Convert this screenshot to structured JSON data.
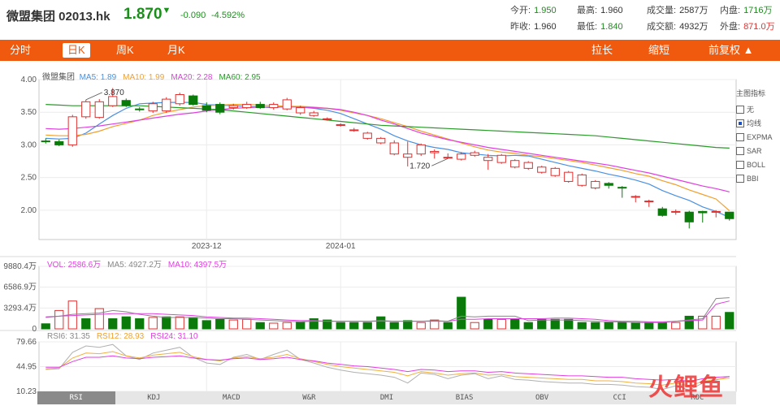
{
  "header": {
    "name": "微盟集团 02013.hk",
    "price": "1.870",
    "price_arrow": "▼",
    "change": "-0.090",
    "change_pct": "-4.592%",
    "stats": [
      {
        "label": "今开:",
        "value": "1.950",
        "color": "#1a8f1a"
      },
      {
        "label": "最高:",
        "value": "1.960",
        "color": "#333333"
      },
      {
        "label": "成交量:",
        "value": "2587万",
        "color": "#333333"
      },
      {
        "label": "内盘:",
        "value": "1716万",
        "color": "#1a8f1a"
      },
      {
        "label": "昨收:",
        "value": "1.960",
        "color": "#333333"
      },
      {
        "label": "最低:",
        "value": "1.840",
        "color": "#1a8f1a"
      },
      {
        "label": "成交额:",
        "value": "4932万",
        "color": "#333333"
      },
      {
        "label": "外盘:",
        "value": "871.0万",
        "color": "#e03030"
      }
    ]
  },
  "tabs": [
    "分时",
    "日K",
    "周K",
    "月K"
  ],
  "active_tab": "日K",
  "right_tabs": [
    "拉长",
    "缩短",
    "前复权 ▲"
  ],
  "side_panel": {
    "title": "主图指标",
    "options": [
      {
        "label": "无",
        "checked": false
      },
      {
        "label": "均线",
        "checked": true
      },
      {
        "label": "EXPMA",
        "checked": false
      },
      {
        "label": "SAR",
        "checked": false
      },
      {
        "label": "BOLL",
        "checked": false
      },
      {
        "label": "BBI",
        "checked": false
      }
    ]
  },
  "bottom_tabs": [
    "RSI",
    "KDJ",
    "MACD",
    "W&R",
    "DMI",
    "BIAS",
    "OBV",
    "CCI",
    "ROC"
  ],
  "active_bottom_tab": "RSI",
  "watermark": "火鲤鱼",
  "colors": {
    "up": "#e03030",
    "down": "#0a7a0a",
    "ma5": "#4a90e2",
    "ma10": "#f0a030",
    "ma20": "#e040e0",
    "ma60": "#2a9a2a",
    "accent": "#f05a0f"
  },
  "chart_data": [
    {
      "type": "candlestick",
      "title": "微盟集团",
      "legend": [
        {
          "name": "MA5",
          "value": "1.89"
        },
        {
          "name": "MA10",
          "value": "1.99"
        },
        {
          "name": "MA20",
          "value": "2.28"
        },
        {
          "name": "MA60",
          "value": "2.95"
        }
      ],
      "ylim": [
        1.55,
        4.0
      ],
      "yticks": [
        "4.00",
        "3.50",
        "3.00",
        "2.50",
        "2.00"
      ],
      "xticks": [
        {
          "label": "2023-12",
          "index": 12
        },
        {
          "label": "2024-01",
          "index": 22
        }
      ],
      "annotations": [
        {
          "text": "3.870",
          "index": 3
        },
        {
          "text": "1.720",
          "index": 30
        }
      ],
      "open": [
        3.06,
        3.05,
        3.0,
        3.43,
        3.42,
        3.6,
        3.68,
        3.55,
        3.52,
        3.52,
        3.63,
        3.75,
        3.6,
        3.62,
        3.57,
        3.57,
        3.62,
        3.57,
        3.55,
        3.49,
        3.45,
        3.4,
        3.31,
        3.23,
        3.1,
        3.03,
        2.86,
        2.81,
        2.86,
        2.88,
        2.81,
        2.78,
        2.84,
        2.76,
        2.73,
        2.66,
        2.64,
        2.58,
        2.53,
        2.44,
        2.38,
        2.34,
        2.41,
        2.35,
        2.21,
        2.14,
        2.02,
        1.98,
        1.97,
        1.98,
        1.98,
        1.97
      ],
      "close": [
        3.05,
        3.0,
        3.43,
        3.66,
        3.66,
        3.74,
        3.6,
        3.54,
        3.63,
        3.7,
        3.77,
        3.62,
        3.53,
        3.5,
        3.6,
        3.62,
        3.57,
        3.62,
        3.69,
        3.57,
        3.49,
        3.4,
        3.31,
        3.23,
        3.18,
        3.1,
        3.03,
        2.86,
        3.0,
        2.9,
        2.81,
        2.86,
        2.88,
        2.81,
        2.84,
        2.76,
        2.73,
        2.66,
        2.64,
        2.58,
        2.54,
        2.44,
        2.38,
        2.34,
        2.21,
        2.14,
        1.92,
        1.98,
        1.82,
        1.96,
        1.98,
        1.87
      ],
      "high": [
        3.1,
        3.08,
        3.46,
        3.69,
        3.7,
        3.87,
        3.71,
        3.58,
        3.66,
        3.73,
        3.8,
        3.77,
        3.65,
        3.65,
        3.63,
        3.66,
        3.66,
        3.65,
        3.72,
        3.6,
        3.52,
        3.42,
        3.33,
        3.26,
        3.2,
        3.12,
        3.07,
        3.05,
        3.02,
        2.93,
        2.87,
        2.89,
        2.91,
        2.86,
        2.86,
        2.78,
        2.75,
        2.68,
        2.66,
        2.6,
        2.56,
        2.46,
        2.43,
        2.37,
        2.23,
        2.16,
        2.05,
        2.01,
        1.99,
        1.99,
        2.0,
        1.96
      ],
      "low": [
        3.02,
        2.98,
        2.97,
        3.4,
        3.4,
        3.58,
        3.58,
        3.51,
        3.49,
        3.49,
        3.6,
        3.6,
        3.5,
        3.47,
        3.54,
        3.55,
        3.55,
        3.54,
        3.53,
        3.46,
        3.43,
        3.37,
        3.28,
        3.2,
        3.08,
        3.01,
        2.84,
        2.67,
        2.83,
        2.79,
        2.79,
        2.76,
        2.82,
        2.62,
        2.71,
        2.64,
        2.62,
        2.56,
        2.51,
        2.42,
        2.36,
        2.32,
        2.33,
        2.19,
        2.12,
        2.05,
        1.9,
        1.93,
        1.72,
        1.81,
        1.89,
        1.84
      ],
      "series": [
        {
          "name": "MA5",
          "values": [
            3.1,
            3.09,
            3.1,
            3.18,
            3.32,
            3.45,
            3.56,
            3.63,
            3.64,
            3.65,
            3.65,
            3.65,
            3.62,
            3.61,
            3.6,
            3.59,
            3.58,
            3.57,
            3.59,
            3.58,
            3.56,
            3.53,
            3.48,
            3.4,
            3.32,
            3.24,
            3.14,
            3.06,
            3.0,
            2.96,
            2.93,
            2.88,
            2.86,
            2.84,
            2.83,
            2.84,
            2.83,
            2.78,
            2.73,
            2.68,
            2.64,
            2.6,
            2.55,
            2.51,
            2.46,
            2.4,
            2.3,
            2.22,
            2.15,
            2.05,
            1.98,
            1.89
          ]
        },
        {
          "name": "MA10",
          "values": [
            3.15,
            3.14,
            3.14,
            3.16,
            3.21,
            3.28,
            3.33,
            3.38,
            3.45,
            3.5,
            3.54,
            3.58,
            3.6,
            3.61,
            3.62,
            3.62,
            3.61,
            3.6,
            3.59,
            3.59,
            3.58,
            3.56,
            3.53,
            3.49,
            3.45,
            3.4,
            3.34,
            3.28,
            3.21,
            3.15,
            3.09,
            3.03,
            2.97,
            2.92,
            2.89,
            2.87,
            2.84,
            2.82,
            2.79,
            2.76,
            2.73,
            2.69,
            2.65,
            2.61,
            2.56,
            2.52,
            2.45,
            2.39,
            2.31,
            2.24,
            2.17,
            1.99
          ]
        },
        {
          "name": "MA20",
          "values": [
            3.25,
            3.24,
            3.25,
            3.27,
            3.29,
            3.32,
            3.35,
            3.38,
            3.41,
            3.44,
            3.47,
            3.49,
            3.52,
            3.54,
            3.56,
            3.57,
            3.58,
            3.58,
            3.58,
            3.58,
            3.57,
            3.56,
            3.54,
            3.5,
            3.45,
            3.38,
            3.32,
            3.25,
            3.18,
            3.13,
            3.08,
            3.04,
            3.0,
            2.96,
            2.93,
            2.9,
            2.87,
            2.84,
            2.81,
            2.78,
            2.75,
            2.72,
            2.69,
            2.65,
            2.61,
            2.57,
            2.52,
            2.47,
            2.42,
            2.37,
            2.33,
            2.28
          ]
        },
        {
          "name": "MA60",
          "values": [
            3.62,
            3.61,
            3.6,
            3.6,
            3.6,
            3.6,
            3.6,
            3.6,
            3.59,
            3.58,
            3.57,
            3.56,
            3.55,
            3.54,
            3.52,
            3.5,
            3.48,
            3.46,
            3.44,
            3.42,
            3.4,
            3.38,
            3.36,
            3.34,
            3.32,
            3.3,
            3.29,
            3.28,
            3.27,
            3.26,
            3.25,
            3.24,
            3.23,
            3.22,
            3.21,
            3.2,
            3.19,
            3.18,
            3.17,
            3.16,
            3.15,
            3.14,
            3.12,
            3.1,
            3.08,
            3.06,
            3.04,
            3.02,
            3.0,
            2.98,
            2.96,
            2.95
          ]
        }
      ]
    },
    {
      "type": "bar",
      "title": "VOL",
      "legend": [
        {
          "name": "VOL",
          "value": "2586.6万"
        },
        {
          "name": "MA5",
          "value": "4927.2万"
        },
        {
          "name": "MA10",
          "value": "4397.5万"
        }
      ],
      "yticks": [
        "9880.4万",
        "6586.9万",
        "3293.4万",
        "0"
      ],
      "ylim": [
        0,
        9880.4
      ],
      "values": [
        800,
        2900,
        4400,
        1600,
        3200,
        1600,
        1900,
        1600,
        1800,
        1900,
        1900,
        1800,
        1300,
        1500,
        1400,
        1500,
        1000,
        900,
        1000,
        1100,
        1600,
        1400,
        1000,
        1000,
        1000,
        1900,
        1000,
        1300,
        1000,
        1400,
        1000,
        5000,
        1000,
        1500,
        1500,
        1500,
        1000,
        1500,
        1500,
        1500,
        1000,
        1000,
        1000,
        1000,
        1000,
        1000,
        1000,
        1000,
        2000,
        2000,
        2000,
        2600
      ],
      "series": [
        {
          "name": "MA5",
          "values": [
            1800,
            2000,
            2300,
            2400,
            2500,
            2900,
            2700,
            2300,
            2000,
            1800,
            1800,
            1800,
            1700,
            1600,
            1600,
            1500,
            1400,
            1300,
            1200,
            1100,
            1200,
            1200,
            1200,
            1200,
            1200,
            1300,
            1200,
            1200,
            1200,
            1300,
            1200,
            2000,
            1900,
            2000,
            2000,
            2000,
            1300,
            1400,
            1400,
            1400,
            1300,
            1200,
            1100,
            1100,
            1000,
            1000,
            1000,
            1200,
            1400,
            1600,
            4800,
            4927
          ]
        },
        {
          "name": "MA10",
          "values": [
            1900,
            2000,
            2100,
            2200,
            2300,
            2400,
            2400,
            2400,
            2400,
            2300,
            2200,
            2100,
            1900,
            1800,
            1700,
            1700,
            1600,
            1500,
            1400,
            1300,
            1300,
            1200,
            1200,
            1200,
            1200,
            1200,
            1200,
            1200,
            1200,
            1200,
            1200,
            1500,
            1500,
            1600,
            1600,
            1600,
            1600,
            1600,
            1700,
            1700,
            1600,
            1500,
            1300,
            1200,
            1200,
            1100,
            1100,
            1200,
            1300,
            1400,
            3900,
            4397
          ]
        }
      ],
      "up": [
        false,
        true,
        true,
        false,
        true,
        false,
        false,
        false,
        true,
        false,
        true,
        false,
        false,
        false,
        true,
        true,
        false,
        true,
        true,
        false,
        false,
        false,
        false,
        false,
        false,
        false,
        false,
        false,
        true,
        true,
        false,
        false,
        true,
        false,
        true,
        false,
        false,
        false,
        false,
        false,
        false,
        false,
        false,
        false,
        false,
        false,
        false,
        true,
        false,
        true,
        true,
        false
      ]
    },
    {
      "type": "line",
      "title": "RSI",
      "legend": [
        {
          "name": "RSI6",
          "value": "31.35"
        },
        {
          "name": "RSI12",
          "value": "28.93"
        },
        {
          "name": "RSI24",
          "value": "31.10"
        }
      ],
      "yticks": [
        "79.66",
        "44.95",
        "10.23"
      ],
      "ylim": [
        10.23,
        79.66
      ],
      "series": [
        {
          "name": "RSI6",
          "values": [
            41,
            42,
            65,
            74,
            72,
            76,
            60,
            55,
            64,
            68,
            72,
            58,
            50,
            48,
            58,
            62,
            55,
            62,
            68,
            55,
            50,
            44,
            40,
            37,
            35,
            33,
            30,
            22,
            36,
            34,
            28,
            33,
            35,
            28,
            32,
            27,
            26,
            24,
            23,
            22,
            22,
            20,
            20,
            19,
            17,
            16,
            13,
            18,
            12,
            22,
            26,
            31.35
          ]
        },
        {
          "name": "RSI12",
          "values": [
            42,
            43,
            57,
            64,
            63,
            66,
            60,
            57,
            61,
            63,
            65,
            59,
            55,
            53,
            57,
            59,
            56,
            58,
            62,
            56,
            52,
            48,
            45,
            43,
            41,
            39,
            37,
            32,
            38,
            36,
            33,
            35,
            36,
            33,
            34,
            31,
            30,
            29,
            28,
            27,
            27,
            25,
            25,
            24,
            22,
            21,
            19,
            22,
            18,
            24,
            27,
            28.93
          ]
        },
        {
          "name": "RSI24",
          "values": [
            44,
            44,
            52,
            58,
            58,
            60,
            57,
            56,
            58,
            59,
            60,
            57,
            55,
            54,
            56,
            57,
            55,
            56,
            58,
            55,
            53,
            50,
            48,
            46,
            45,
            43,
            41,
            38,
            41,
            40,
            38,
            39,
            39,
            37,
            38,
            36,
            35,
            34,
            33,
            32,
            32,
            31,
            30,
            30,
            28,
            27,
            26,
            27,
            24,
            28,
            30,
            31.1
          ]
        }
      ]
    }
  ]
}
